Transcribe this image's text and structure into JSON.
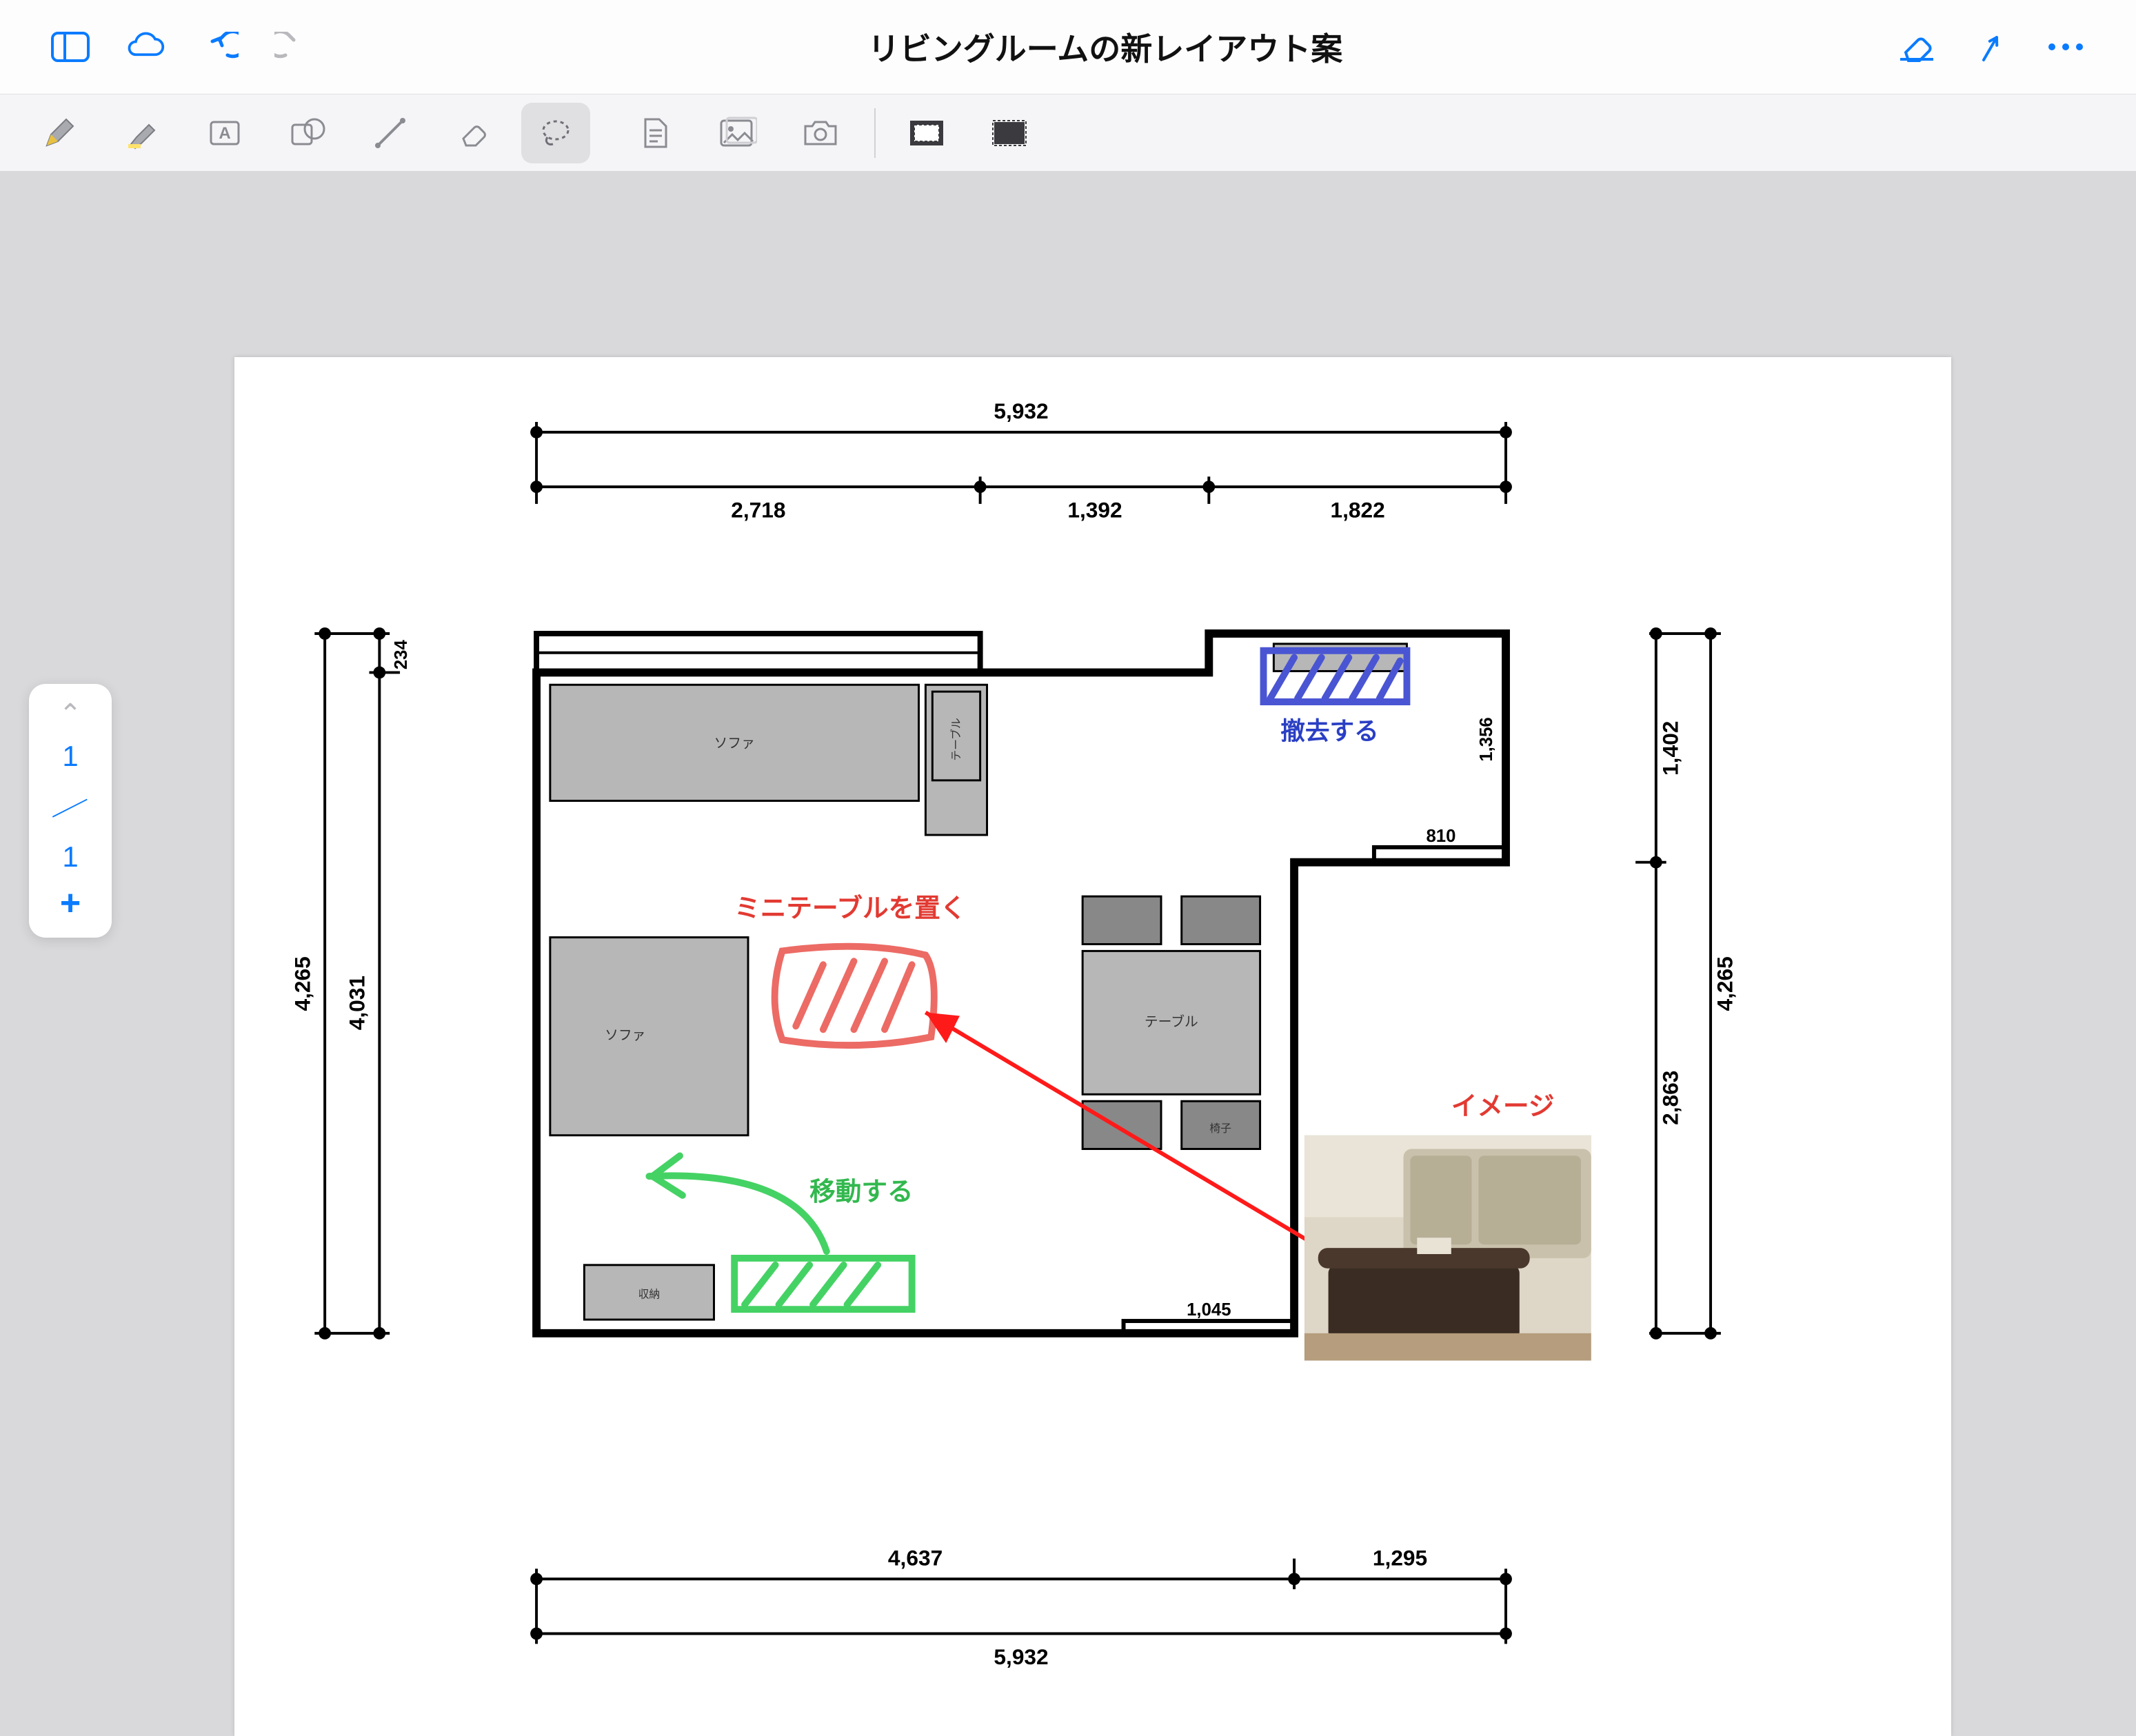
{
  "document": {
    "title": "リビングルームの新レイアウト案"
  },
  "pager": {
    "current": "1",
    "total": "1"
  },
  "annotations": {
    "mini_table": "ミニテーブルを置く",
    "remove": "撤去する",
    "move": "移動する",
    "image_label": "イメージ"
  },
  "furniture": {
    "sofa": "ソファ",
    "table": "テーブル",
    "chair": "椅子",
    "storage": "収納"
  },
  "dimensions": {
    "top_total": "5,932",
    "top_a": "2,718",
    "top_b": "1,392",
    "top_c": "1,822",
    "left_total": "4,265",
    "left_inner": "4,031",
    "left_inner_top": "234",
    "right_total": "4,265",
    "right_a": "1,402",
    "right_b": "2,863",
    "alcove_w": "810",
    "alcove_h": "1,356",
    "bottom_door": "1,045",
    "bottom_a": "4,637",
    "bottom_b": "1,295",
    "bottom_total": "5,932"
  }
}
